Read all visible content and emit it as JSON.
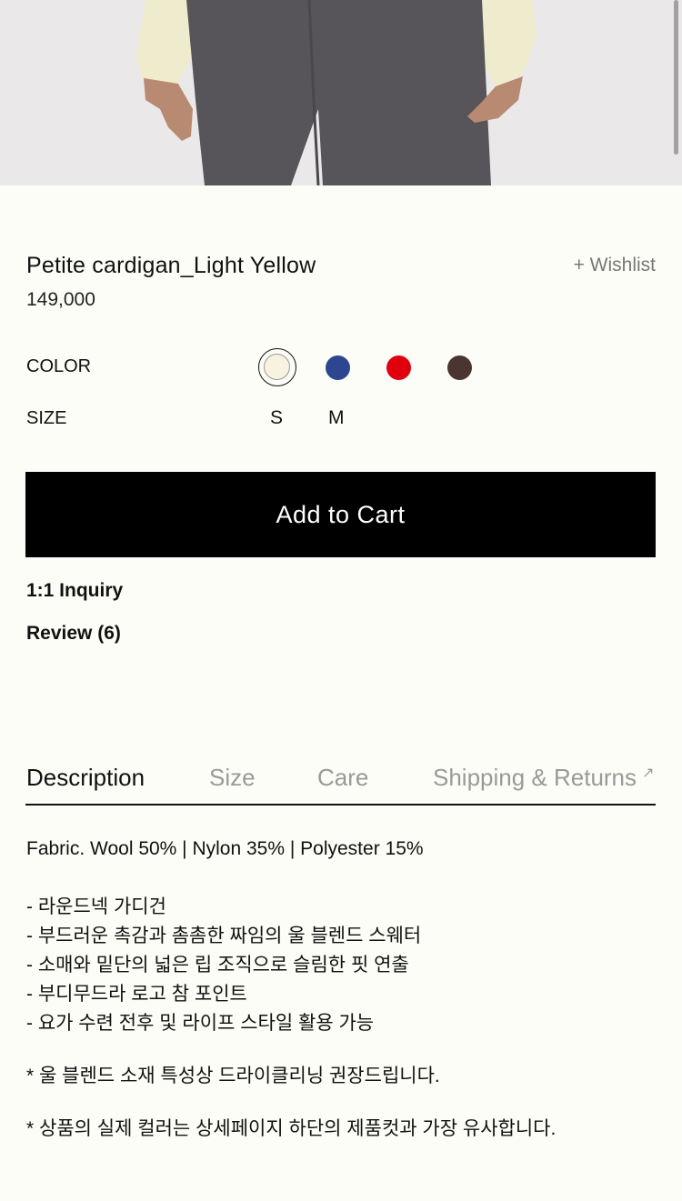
{
  "product": {
    "name": "Petite cardigan_Light Yellow",
    "price": "149,000",
    "wishlist_label": "+ Wishlist"
  },
  "options": {
    "color_label": "COLOR",
    "size_label": "SIZE",
    "colors": [
      {
        "name": "light-yellow",
        "hex": "#f8f3e1",
        "selected": true
      },
      {
        "name": "navy-blue",
        "hex": "#2c4690",
        "selected": false
      },
      {
        "name": "red",
        "hex": "#e0000d",
        "selected": false
      },
      {
        "name": "brown",
        "hex": "#4a3530",
        "selected": false
      }
    ],
    "sizes": [
      "S",
      "M"
    ]
  },
  "actions": {
    "add_to_cart": "Add to Cart",
    "inquiry": "1:1 Inquiry",
    "review": "Review (6)"
  },
  "tabs": [
    "Description",
    "Size",
    "Care",
    "Shipping & Returns"
  ],
  "tab_arrow": "↗",
  "description": {
    "fabric": "Fabric. Wool 50% | Nylon 35% | Polyester 15%",
    "bullets": [
      "- 라운드넥 가디건",
      "- 부드러운 촉감과 촘촘한 짜임의 울 블렌드 스웨터",
      "- 소매와 밑단의 넓은 립 조직으로 슬림한 핏 연출",
      "- 부디무드라 로고 참 포인트",
      "- 요가 수련 전후 및 라이프 스타일 활용 가능"
    ],
    "note1": "* 울 블렌드 소재 특성상 드라이클리닝 권장드립니다.",
    "note2": "* 상품의 실제 컬러는 상세페이지 하단의 제품컷과 가장 유사합니다."
  },
  "colors": {
    "background": "#fdfdf8",
    "button": "#000000",
    "muted_text": "#999999"
  }
}
